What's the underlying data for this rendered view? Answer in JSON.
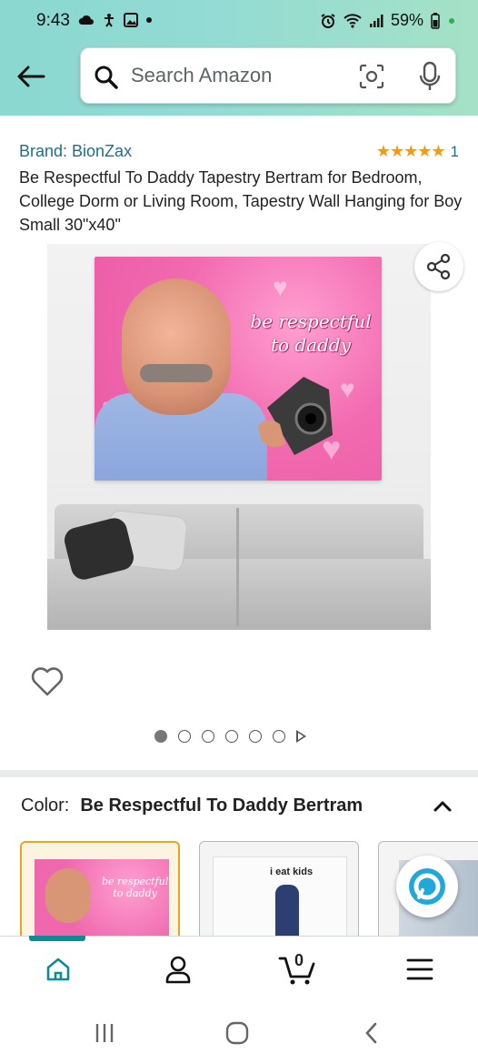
{
  "status_bar": {
    "time": "9:43",
    "battery_percent": "59%",
    "left_icons": [
      "cloud-icon",
      "accessibility-icon",
      "gallery-icon",
      "dot-icon"
    ],
    "right_icons": [
      "alarm-icon",
      "wifi-icon",
      "signal-icon",
      "battery-icon"
    ]
  },
  "header": {
    "back_icon": "arrow-left-icon",
    "search": {
      "placeholder": "Search Amazon",
      "icons": [
        "search-icon",
        "camera-scan-icon",
        "microphone-icon"
      ]
    },
    "background_colors": [
      "#8ad8d0",
      "#a5e1c6"
    ]
  },
  "product": {
    "brand": "Brand: BionZax",
    "rating_stars": 5,
    "rating_count": "1",
    "title": "Be Respectful To Daddy Tapestry Bertram for Bedroom, College Dorm or Living Room, Tapestry Wall Hanging for Boy Small 30\"x40\"",
    "image_text": [
      "be respectful",
      "to daddy"
    ],
    "image_count": 6,
    "active_image_index": 0,
    "has_video": true
  },
  "variation": {
    "label": "Color:",
    "value": "Be Respectful To Daddy Bertram",
    "swatches": [
      {
        "text": [
          "be respectful",
          "to daddy"
        ],
        "selected": true
      },
      {
        "text": [
          "i eat kids"
        ],
        "selected": false
      },
      {
        "text": [],
        "selected": false
      }
    ]
  },
  "bottom_nav": {
    "items": [
      "home-icon",
      "account-icon",
      "cart-icon",
      "menu-icon"
    ],
    "cart_count": "0",
    "accent_color": "#0f8b93"
  },
  "colors": {
    "link": "#1e6f86",
    "star": "#f09a1c",
    "selected_border": "#e6a61f"
  }
}
